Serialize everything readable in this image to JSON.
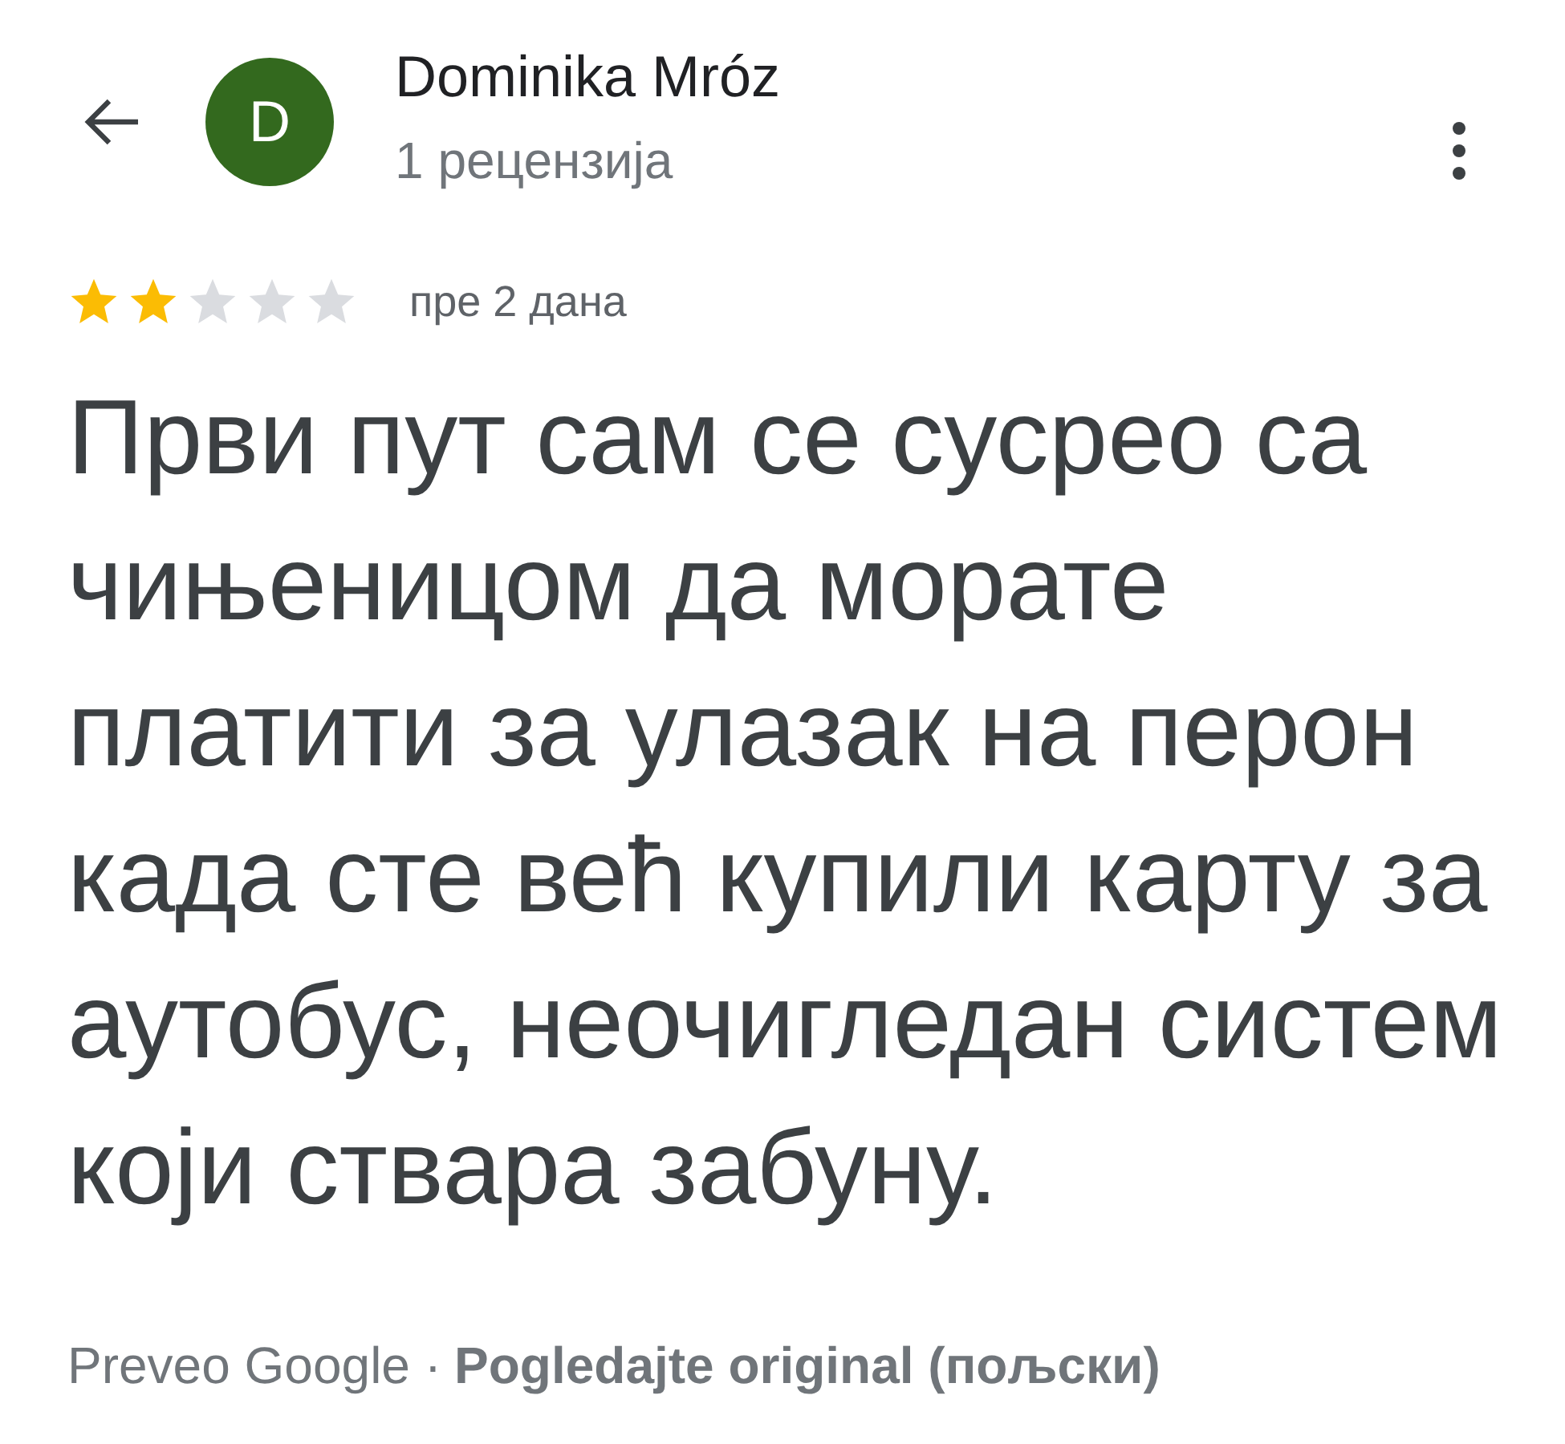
{
  "header": {
    "avatar_letter": "D",
    "name": "Dominika Mróz",
    "subtitle": "1 рецензија"
  },
  "review": {
    "stars": 2,
    "time": "пре 2 дана",
    "text": "Први пут сам се сусрео са чињеницом да морате платити за улазак на перон када сте већ купили карту за аутобус, неочигледан систем који ствара забуну."
  },
  "footer": {
    "translated_by": "Preveo Google ·",
    "original_link": "Pogledajte original (пољски)"
  }
}
